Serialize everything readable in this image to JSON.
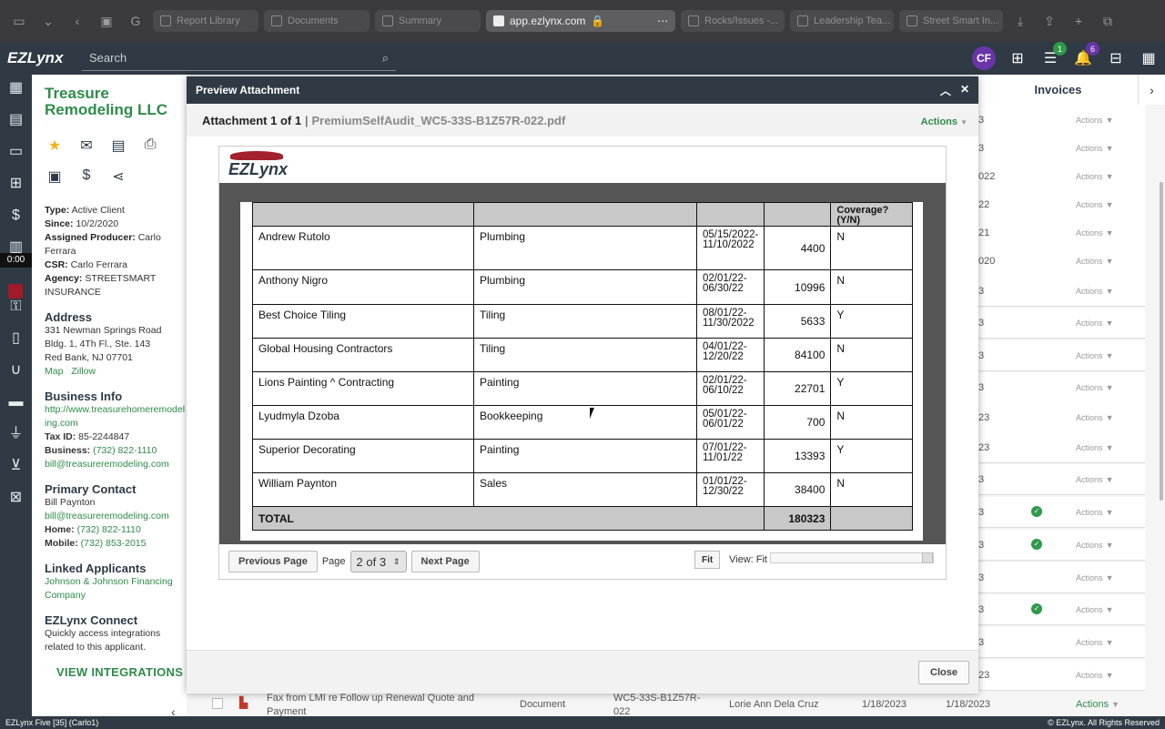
{
  "browser": {
    "tabs": [
      {
        "label": "Report Library"
      },
      {
        "label": "Documents"
      },
      {
        "label": "Summary"
      },
      {
        "label": "app.ezlynx.com",
        "active": true
      },
      {
        "label": "Rocks/Issues -..."
      },
      {
        "label": "Leadership Tea..."
      },
      {
        "label": "Street Smart In..."
      }
    ]
  },
  "header": {
    "logo": "EZLynx",
    "search_placeholder": "Search",
    "user_initials": "CF",
    "tasks_badge": "1",
    "notifications_badge": "6"
  },
  "timer": "0:00",
  "client": {
    "name": "Treasure Remodeling LLC",
    "type_label": "Type:",
    "type": "Active Client",
    "since_label": "Since:",
    "since": "10/2/2020",
    "producer_label": "Assigned Producer:",
    "producer": "Carlo Ferrara",
    "csr_label": "CSR:",
    "csr": "Carlo Ferrara",
    "agency_label": "Agency:",
    "agency": "STREETSMART INSURANCE",
    "address_title": "Address",
    "address_line1": "331 Newman Springs Road",
    "address_line2": "Bldg. 1, 4Th Fl., Ste. 143",
    "address_line3": "Red Bank, NJ 07701",
    "map_link": "Map",
    "zillow_link": "Zillow",
    "business_title": "Business Info",
    "website": "http://www.treasurehomeremodeling.com",
    "taxid_label": "Tax ID:",
    "taxid": "85-2244847",
    "business_phone_label": "Business:",
    "business_phone": "(732) 822-1110",
    "business_email": "bill@treasureremodeling.com",
    "primary_title": "Primary Contact",
    "primary_name": "Bill Paynton",
    "primary_email": "bill@treasureremodeling.com",
    "home_label": "Home:",
    "home_phone": "(732) 822-1110",
    "mobile_label": "Mobile:",
    "mobile_phone": "(732) 853-2015",
    "linked_title": "Linked Applicants",
    "linked_name": "Johnson & Johnson Financing Company",
    "connect_title": "EZLynx Connect",
    "connect_desc": "Quickly access integrations related to this applicant.",
    "view_integrations": "VIEW INTEGRATIONS"
  },
  "background": {
    "invoices_header": "Invoices",
    "rows": [
      {
        "frag": "3",
        "action": "Actions",
        "check": false
      },
      {
        "frag": "3",
        "action": "Actions",
        "check": false
      },
      {
        "frag": "022",
        "action": "Actions",
        "check": false
      },
      {
        "frag": "22",
        "action": "Actions",
        "check": false
      },
      {
        "frag": "21",
        "action": "Actions",
        "check": false
      },
      {
        "frag": "020",
        "action": "Actions",
        "check": false
      },
      {
        "frag": "3",
        "action": "Actions",
        "check": false
      },
      {
        "frag": "3",
        "action": "Actions",
        "check": false
      },
      {
        "frag": "3",
        "action": "Actions",
        "check": false
      },
      {
        "frag": "3",
        "action": "Actions",
        "check": false
      },
      {
        "frag": "23",
        "action": "Actions",
        "check": false
      },
      {
        "frag": "23",
        "action": "Actions",
        "check": false
      },
      {
        "frag": "3",
        "action": "Actions",
        "check": false
      },
      {
        "frag": "3",
        "action": "Actions",
        "check": true
      },
      {
        "frag": "3",
        "action": "Actions",
        "check": true
      },
      {
        "frag": "3",
        "action": "Actions",
        "check": false
      },
      {
        "frag": "3",
        "action": "Actions",
        "check": true
      },
      {
        "frag": "3",
        "action": "Actions",
        "check": false
      },
      {
        "frag": "23",
        "action": "Actions",
        "check": false
      }
    ],
    "bottom_row": {
      "description": "Fax from LMI re Follow up Renewal Quote and Payment",
      "type": "Document",
      "policy": "WC5-33S-B1Z57R-022",
      "owner": "Lorie Ann Dela Cruz",
      "date1": "1/18/2023",
      "date2": "1/18/2023",
      "action": "Actions"
    }
  },
  "modal": {
    "title": "Preview Attachment",
    "attachment_label": "Attachment 1 of 1",
    "separator": "|",
    "filename": "PremiumSelfAudit_WC5-33S-B1Z57R-022.pdf",
    "actions": "Actions",
    "viewer_logo": "EZLynx",
    "coverage_header": "Coverage? (Y/N)",
    "table_rows": [
      {
        "name": "Andrew Rutolo",
        "trade": "Plumbing",
        "dates": "05/15/2022-11/10/2022",
        "amount": "4400",
        "cov": "N"
      },
      {
        "name": "Anthony Nigro",
        "trade": "Plumbing",
        "dates": "02/01/22-06/30/22",
        "amount": "10996",
        "cov": "N"
      },
      {
        "name": "Best Choice Tiling",
        "trade": "Tiling",
        "dates": "08/01/22-11/30/2022",
        "amount": "5633",
        "cov": "Y"
      },
      {
        "name": "Global Housing Contractors",
        "trade": "Tiling",
        "dates": "04/01/22-12/20/22",
        "amount": "84100",
        "cov": "N"
      },
      {
        "name": "Lions Painting ^ Contracting",
        "trade": "Painting",
        "dates": "02/01/22-06/10/22",
        "amount": "22701",
        "cov": "Y"
      },
      {
        "name": "Lyudmyla Dzoba",
        "trade": "Bookkeeping",
        "dates": "05/01/22-06/01/22",
        "amount": "700",
        "cov": "N"
      },
      {
        "name": "Superior Decorating",
        "trade": "Painting",
        "dates": "07/01/22-11/01/22",
        "amount": "13393",
        "cov": "Y"
      },
      {
        "name": "William Paynton",
        "trade": "Sales",
        "dates": "01/01/22-12/30/22",
        "amount": "38400",
        "cov": "N"
      }
    ],
    "total_label": "TOTAL",
    "total_value": "180323",
    "prev_page": "Previous Page",
    "page_label": "Page",
    "page_value": "2 of 3",
    "next_page": "Next Page",
    "fit": "Fit",
    "view_label": "View: Fit",
    "zoom_level": 1.0,
    "close": "Close"
  },
  "status": {
    "left": "EZLynx Five [35] (Carlo1)",
    "right": "© EZLynx. All Rights Reserved"
  }
}
